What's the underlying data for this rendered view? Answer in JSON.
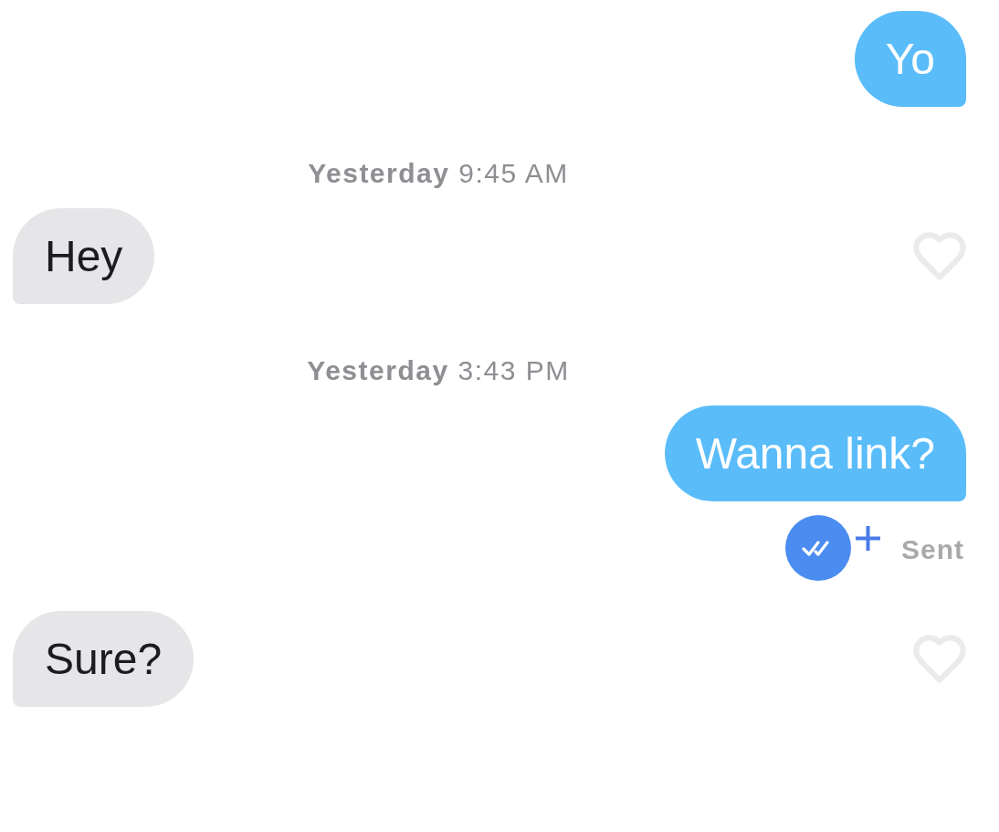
{
  "messages": [
    {
      "kind": "sent",
      "text": "Yo"
    },
    {
      "kind": "timestamp",
      "text": "**Yesterday** 9:45 AM"
    },
    {
      "kind": "received",
      "text": "Hey",
      "liked": false
    },
    {
      "kind": "timestamp",
      "text": "**Yesterday** 3:43 PM"
    },
    {
      "kind": "sent",
      "text": "Wanna link?"
    },
    {
      "kind": "status",
      "text": "Sent"
    },
    {
      "kind": "received",
      "text": "Sure?",
      "liked": false
    }
  ]
}
